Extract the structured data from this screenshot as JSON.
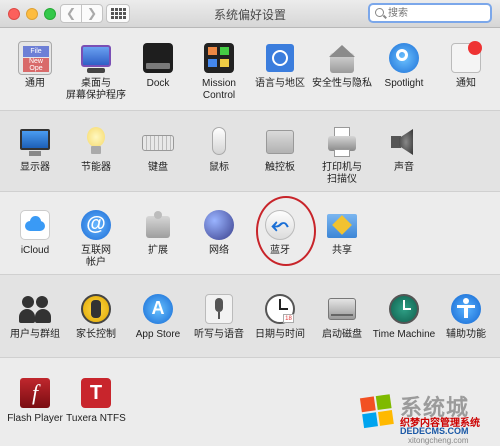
{
  "window": {
    "title": "系统偏好设置"
  },
  "search": {
    "placeholder": "搜索"
  },
  "rows": [
    [
      {
        "name": "general",
        "label": "通用",
        "icon": "general-icon"
      },
      {
        "name": "desktop-screensaver",
        "label": "桌面与\n屏幕保护程序",
        "icon": "desktop-icon"
      },
      {
        "name": "dock",
        "label": "Dock",
        "icon": "dock-icon"
      },
      {
        "name": "mission-control",
        "label": "Mission\nControl",
        "icon": "mission-control-icon"
      },
      {
        "name": "language-region",
        "label": "语言与地区",
        "icon": "language-icon"
      },
      {
        "name": "security-privacy",
        "label": "安全性与隐私",
        "icon": "security-icon"
      },
      {
        "name": "spotlight",
        "label": "Spotlight",
        "icon": "spotlight-icon"
      },
      {
        "name": "notifications",
        "label": "通知",
        "icon": "notifications-icon"
      }
    ],
    [
      {
        "name": "displays",
        "label": "显示器",
        "icon": "display-icon"
      },
      {
        "name": "energy-saver",
        "label": "节能器",
        "icon": "bulb-icon"
      },
      {
        "name": "keyboard",
        "label": "键盘",
        "icon": "keyboard-icon"
      },
      {
        "name": "mouse",
        "label": "鼠标",
        "icon": "mouse-icon"
      },
      {
        "name": "trackpad",
        "label": "触控板",
        "icon": "trackpad-icon"
      },
      {
        "name": "printers-scanners",
        "label": "打印机与\n扫描仪",
        "icon": "printer-icon"
      },
      {
        "name": "sound",
        "label": "声音",
        "icon": "speaker-icon"
      }
    ],
    [
      {
        "name": "icloud",
        "label": "iCloud",
        "icon": "cloud-icon"
      },
      {
        "name": "internet-accounts",
        "label": "互联网\n帐户",
        "icon": "at-icon"
      },
      {
        "name": "extensions",
        "label": "扩展",
        "icon": "puzzle-icon"
      },
      {
        "name": "network",
        "label": "网络",
        "icon": "globe-icon"
      },
      {
        "name": "bluetooth",
        "label": "蓝牙",
        "icon": "bluetooth-icon"
      },
      {
        "name": "sharing",
        "label": "共享",
        "icon": "sharing-icon"
      }
    ],
    [
      {
        "name": "users-groups",
        "label": "用户与群组",
        "icon": "users-icon"
      },
      {
        "name": "parental-controls",
        "label": "家长控制",
        "icon": "parental-icon"
      },
      {
        "name": "app-store",
        "label": "App Store",
        "icon": "app-store-icon"
      },
      {
        "name": "dictation-speech",
        "label": "听写与语音",
        "icon": "microphone-icon"
      },
      {
        "name": "date-time",
        "label": "日期与时间",
        "icon": "clock-icon"
      },
      {
        "name": "startup-disk",
        "label": "启动磁盘",
        "icon": "disk-icon"
      },
      {
        "name": "time-machine",
        "label": "Time Machine",
        "icon": "time-machine-icon"
      },
      {
        "name": "accessibility",
        "label": "辅助功能",
        "icon": "accessibility-icon"
      }
    ],
    [
      {
        "name": "flash-player",
        "label": "Flash Player",
        "icon": "flash-icon"
      },
      {
        "name": "tuxera-ntfs",
        "label": "Tuxera NTFS",
        "icon": "tuxera-icon"
      }
    ]
  ],
  "watermark": {
    "big": "系统城",
    "line1": "织梦内容管理系统",
    "line2": "DEDECMS.COM",
    "line3": "xitongcheng.com"
  }
}
